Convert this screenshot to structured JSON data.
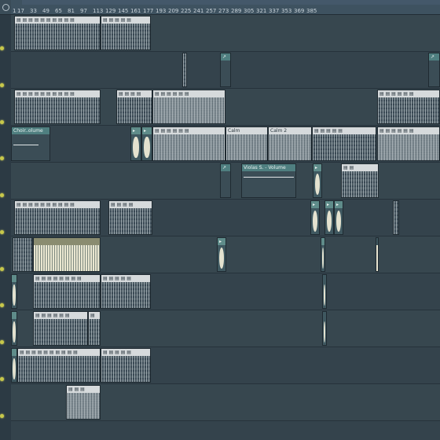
{
  "ruler": {
    "ticks": [
      "1",
      "17",
      "33",
      "49",
      "65",
      "81",
      "97",
      "113",
      "129",
      "145",
      "161",
      "177",
      "193",
      "209",
      "225",
      "241",
      "257",
      "273",
      "289",
      "305",
      "321",
      "337",
      "353",
      "369",
      "385"
    ]
  },
  "clips": {
    "choir_volume": "Choir..olume",
    "calm": "Calm",
    "calm2": "Calm 2",
    "violas_volume": "Violas S. - Volume"
  },
  "icons": {
    "target": "target-icon",
    "pattern": "pattern-icon",
    "audio": "audio-icon",
    "automation": "automation-icon"
  },
  "colors": {
    "background": "#34444f",
    "pattern_header": "#d6dadc",
    "audio_header": "#5f8c8a",
    "track_handle": "#c8c84a"
  }
}
